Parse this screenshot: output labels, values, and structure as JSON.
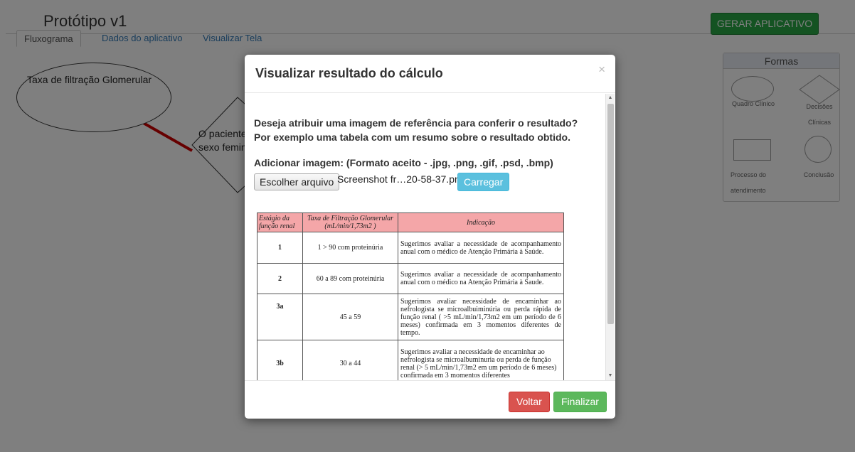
{
  "app": {
    "title": "Protótipo v1",
    "generate_label": "GERAR APLICATIVO",
    "tabs": [
      {
        "label": "Fluxograma",
        "active": true
      },
      {
        "label": "Dados do aplicativo",
        "active": false
      },
      {
        "label": "Visualizar Tela",
        "active": false
      }
    ]
  },
  "canvas": {
    "ellipse_label": "Taxa de filtração Glomerular",
    "diamond_line1": "O paciente",
    "diamond_line2": "sexo femin",
    "connector_color": "#cc0000"
  },
  "shapes_panel": {
    "title": "Formas",
    "items": [
      {
        "label": "Quadro Clínico"
      },
      {
        "label": "Decisões Clínicas"
      },
      {
        "label": "Processo do atendimento"
      },
      {
        "label": "Conclusão"
      }
    ]
  },
  "modal": {
    "title": "Visualizar resultado do cálculo",
    "close": "×",
    "question_line1": "Deseja atribuir uma imagem de referência para conferir o resultado?",
    "question_line2": "Por exemplo uma tabela com um resumo sobre o resultado obtido.",
    "upload_label": "Adicionar imagem: (Formato aceito - .jpg, .png, .gif, .psd, .bmp)",
    "choose_file_label": "Escolher arquivo",
    "file_name": "Screenshot fr…20-58-37.png",
    "upload_button": "Carregar",
    "back_button": "Voltar",
    "finish_button": "Finalizar"
  },
  "reference_table": {
    "headers": [
      "Estágio da função renal",
      "Taxa de Filtração Glomerular (mL/min/1,73m2 )",
      "Indicação"
    ],
    "rows": [
      {
        "stage": "1",
        "rate": "1 > 90 com proteinúria",
        "indication": "Sugerimos avaliar a necessidade de acompanhamento anual com o médico de Atenção Primária à Saúde."
      },
      {
        "stage": "2",
        "rate": "60 a 89 com proteinúria",
        "indication": "Sugerimos avaliar a necessidade de acompanhamento anual com o médico na Atenção Primária à Saude."
      },
      {
        "stage": "3a",
        "rate": "45 a 59",
        "indication": "Sugerimos avaliar necessidade de encaminhar ao nefrologista se microalbuiminúria ou perda rápida de função renal ( >5 mL/min/1,73m2 em um período de 6 meses) confirmada em 3 momentos diferentes de tempo."
      },
      {
        "stage": "3b",
        "rate": "30 a 44",
        "indication": "Sugerimos avaliar a necessidade de encaminhar ao nefrologista se microalbuminuria ou perda de função renal (> 5 mL/min/1,73m2 em um período de 6 meses) confirmada em 3 momentos diferentes"
      }
    ]
  },
  "colors": {
    "table_header_bg": "#f4a6a8",
    "generate_green": "#28a745",
    "upload_blue": "#5bc0de",
    "back_red": "#d9534f",
    "finish_green": "#5cb85c"
  }
}
